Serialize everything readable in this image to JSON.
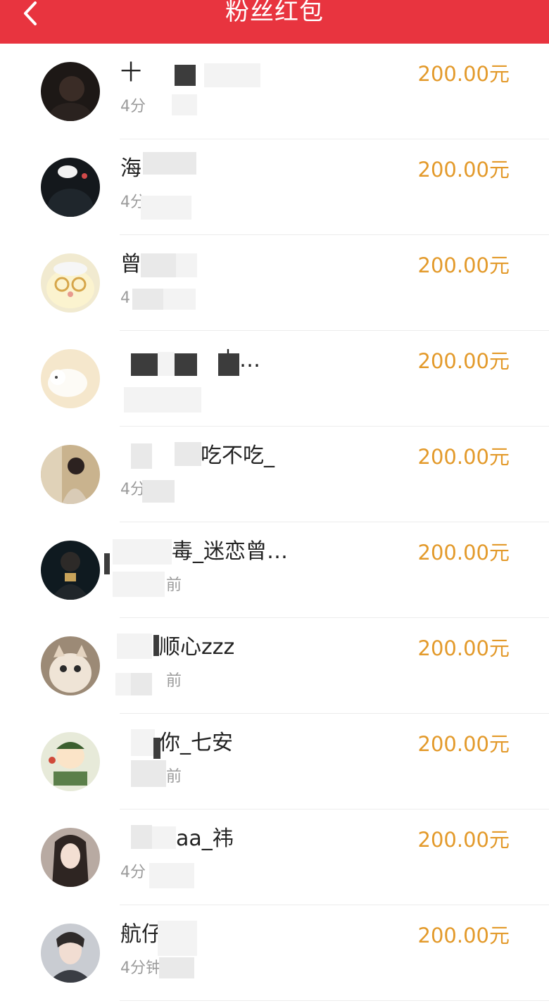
{
  "header": {
    "title": "粉丝红包",
    "back_icon": "chevron-left-icon"
  },
  "colors": {
    "header_bg": "#e8343f",
    "amount": "#e39a2b",
    "time": "#9b9b9b"
  },
  "items": [
    {
      "name": "十",
      "time": "4分",
      "amount": "200.00元"
    },
    {
      "name": "海",
      "time": "4分",
      "amount": "200.00元"
    },
    {
      "name": "曾",
      "time": "4",
      "amount": "200.00元"
    },
    {
      "name": "上…",
      "time": "",
      "amount": "200.00元"
    },
    {
      "name": "吃不吃_",
      "time": "4分",
      "amount": "200.00元"
    },
    {
      "name": "毒_迷恋曾…",
      "time": "前",
      "amount": "200.00元"
    },
    {
      "name": "顺心zzz",
      "time": "前",
      "amount": "200.00元"
    },
    {
      "name": "你_七安",
      "time": "前",
      "amount": "200.00元"
    },
    {
      "name": "aa_祎",
      "time": "4分",
      "amount": "200.00元"
    },
    {
      "name": "航仔 帅",
      "time": "4分钟",
      "amount": "200.00元"
    }
  ]
}
